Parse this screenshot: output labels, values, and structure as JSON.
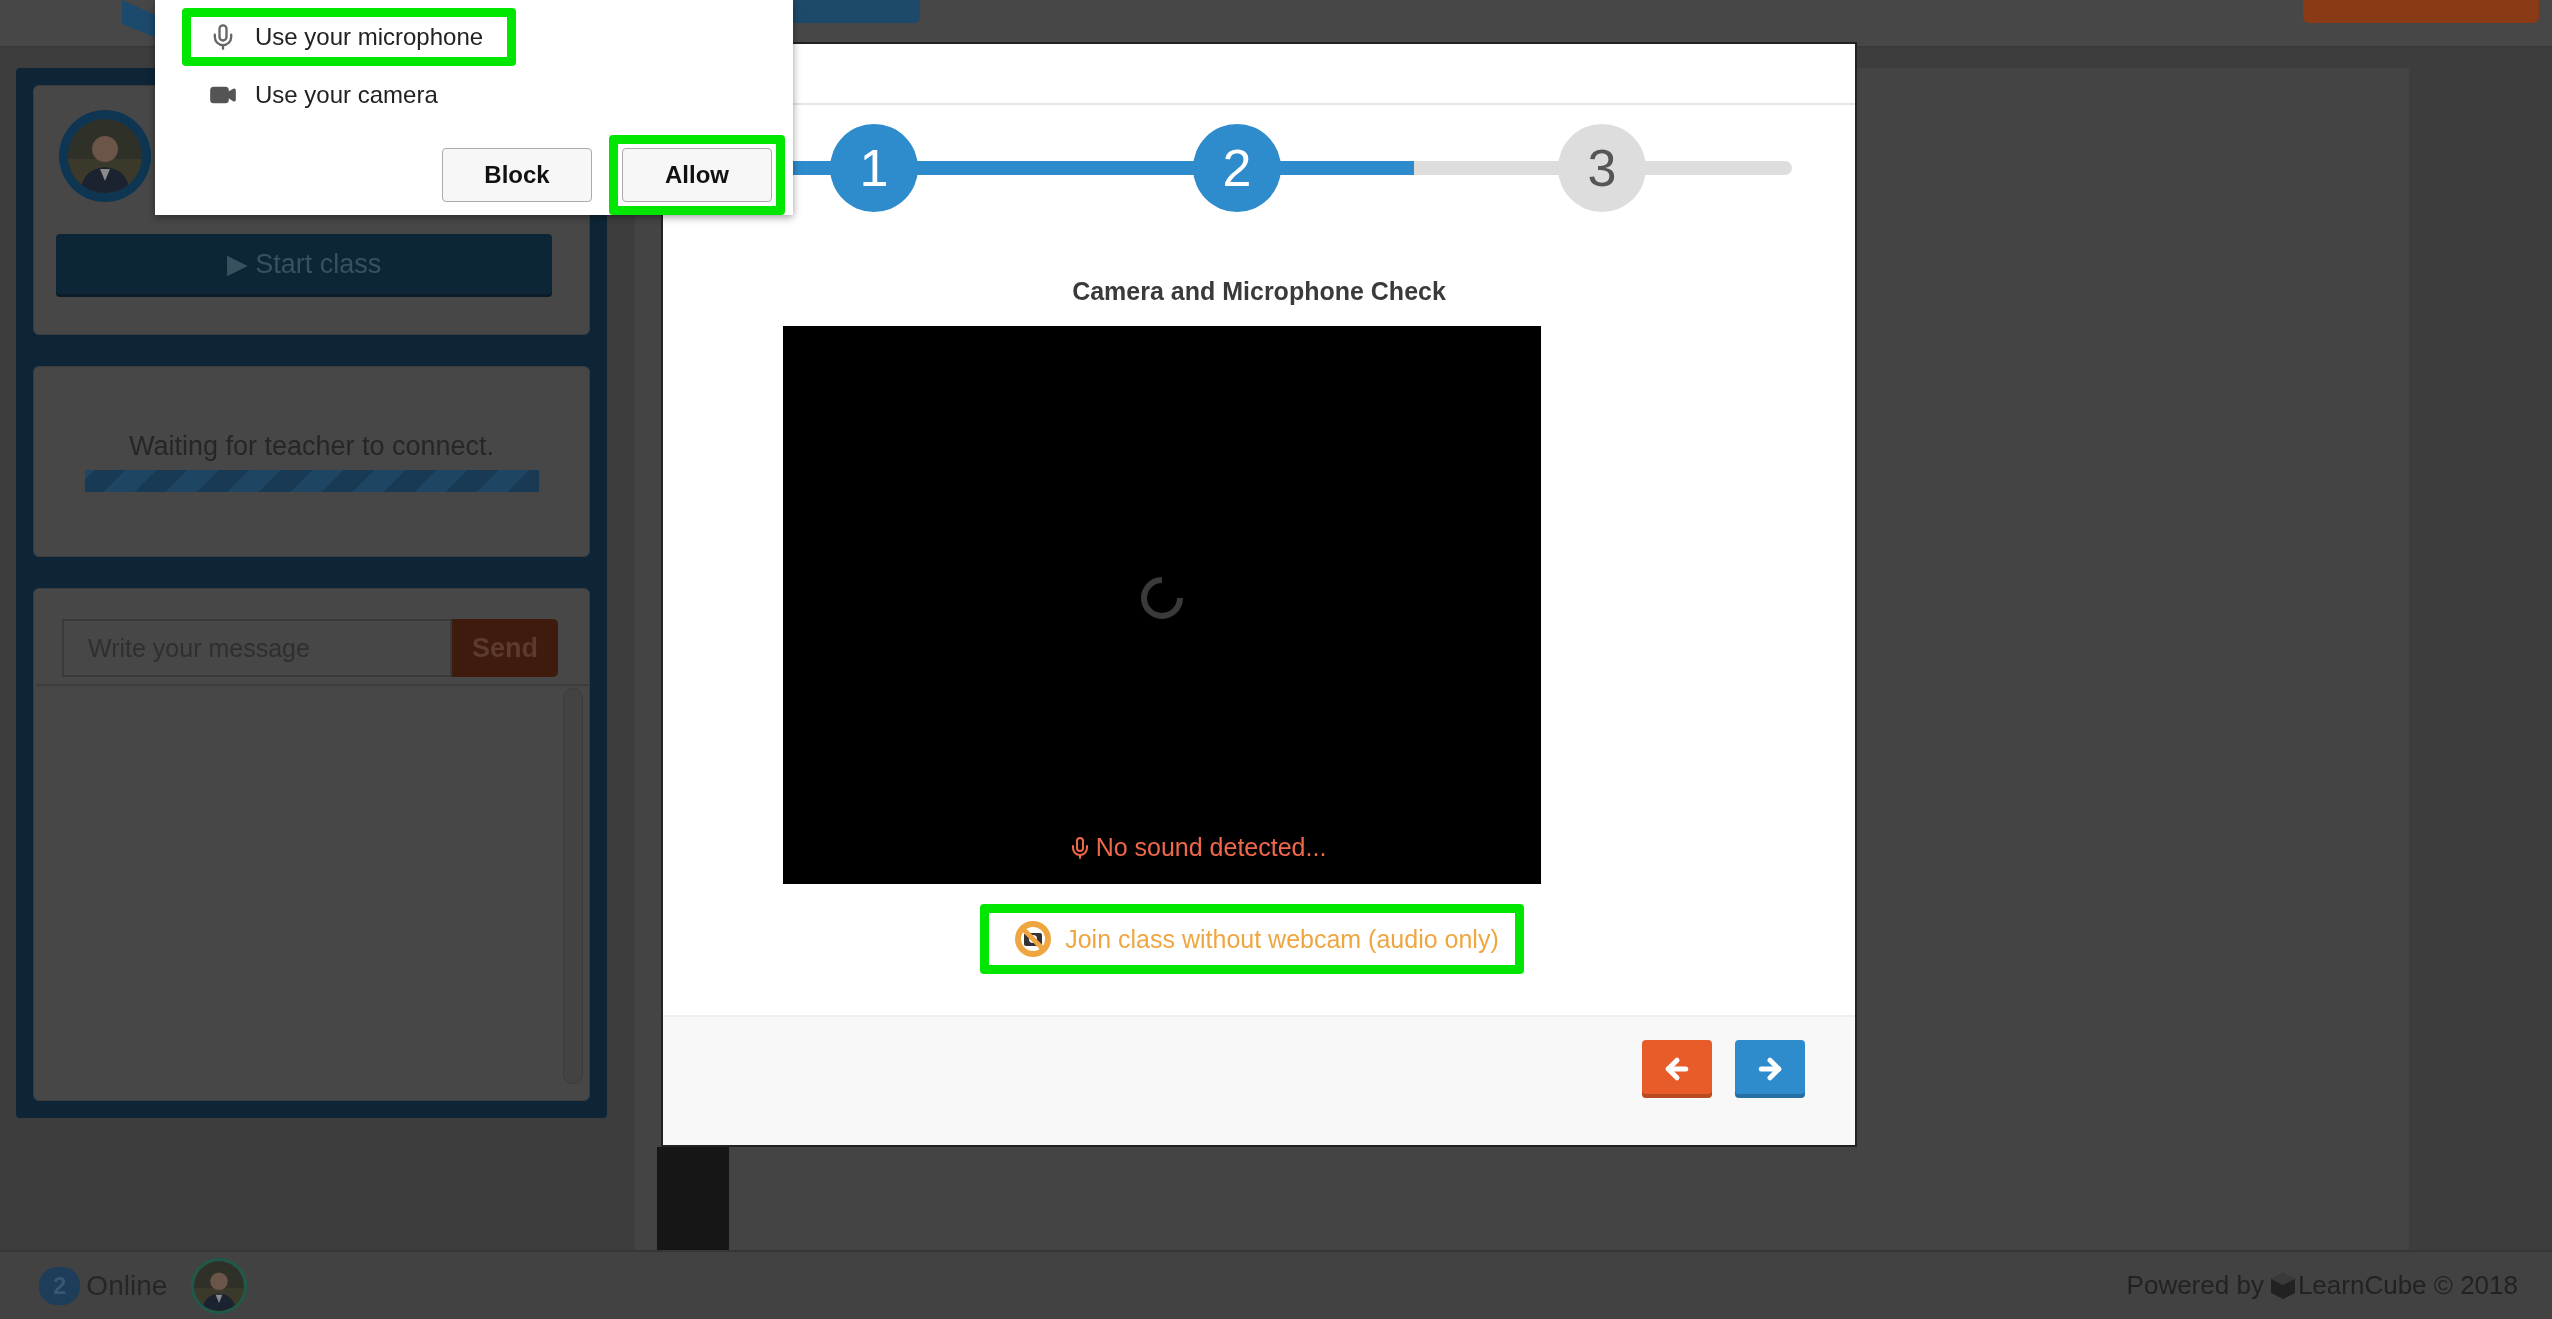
{
  "permission_prompt": {
    "items": [
      {
        "kind": "microphone",
        "label": "Use your microphone",
        "highlighted": true
      },
      {
        "kind": "camera",
        "label": "Use your camera",
        "highlighted": false
      }
    ],
    "buttons": [
      {
        "label": "Block",
        "highlighted": false
      },
      {
        "label": "Allow",
        "highlighted": true
      }
    ]
  },
  "sidebar": {
    "start_button": "▶ Start class",
    "status_message": "Waiting for teacher to connect.",
    "status_progress": {
      "level": 1
    },
    "chat": {
      "placeholder": "Write your message",
      "send_button": "Send"
    }
  },
  "modal": {
    "steps": [
      {
        "label": "1",
        "active": true
      },
      {
        "label": "2",
        "active": true
      },
      {
        "label": "3",
        "active": false
      }
    ],
    "progress": {
      "level": 0.64
    },
    "title": "Camera and Microphone Check",
    "video_status": "No sound detected...",
    "audio_only_link": {
      "label": "Join class without webcam (audio only)",
      "highlighted": true
    },
    "footer_buttons": [
      {
        "kind": "back",
        "color": "#e85c2a"
      },
      {
        "kind": "next",
        "color": "#2e8ccd"
      }
    ]
  },
  "bottom_bar": {
    "online_count": "2",
    "online_label": "Online",
    "credit_prefix": "Powered by",
    "credit_brand": "LearnCube © 2018"
  }
}
